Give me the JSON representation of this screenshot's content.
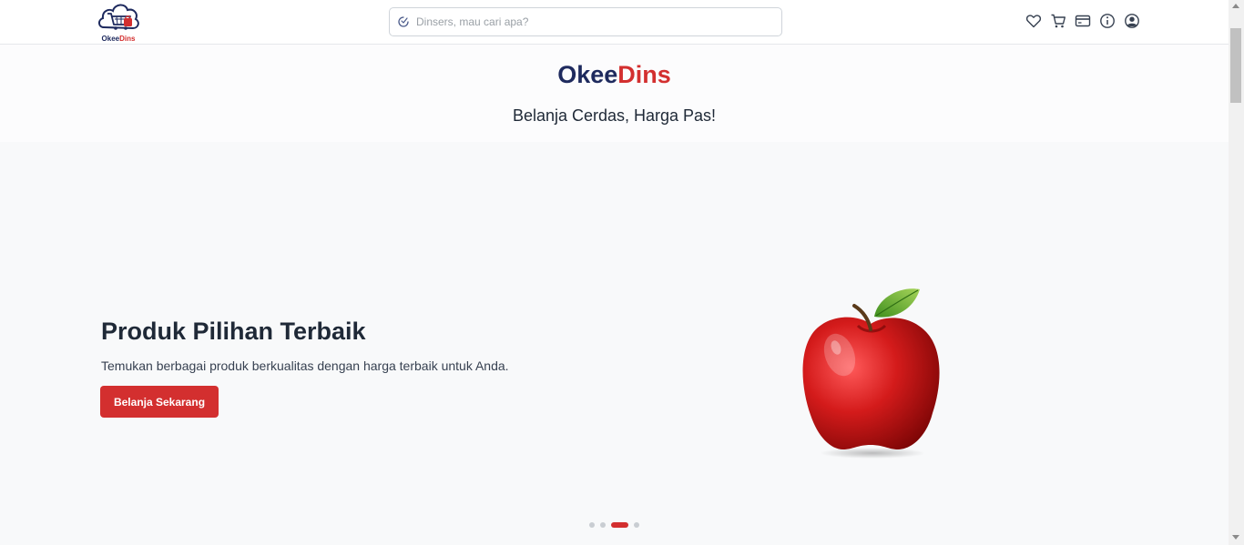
{
  "header": {
    "logo": {
      "name_part1": "Okee",
      "name_part2": "Dins"
    },
    "search": {
      "placeholder": "Dinsers, mau cari apa?",
      "value": ""
    },
    "icons": [
      "heart-icon",
      "cart-icon",
      "credit-card-icon",
      "info-icon",
      "user-account-icon"
    ]
  },
  "brand": {
    "title_part1": "Okee",
    "title_part2": "Dins",
    "tagline": "Belanja Cerdas, Harga Pas!"
  },
  "hero": {
    "title": "Produk Pilihan Terbaik",
    "description": "Temukan berbagai produk berkualitas dengan harga terbaik untuk Anda.",
    "cta_label": "Belanja Sekarang",
    "image_subject": "red apple",
    "slides_count": 4,
    "active_slide": 3
  },
  "colors": {
    "navy": "#1e2a5e",
    "brand_red": "#d32f2f",
    "hero_bg": "#f8f9fa",
    "dot_inactive": "#c9cdd2"
  }
}
